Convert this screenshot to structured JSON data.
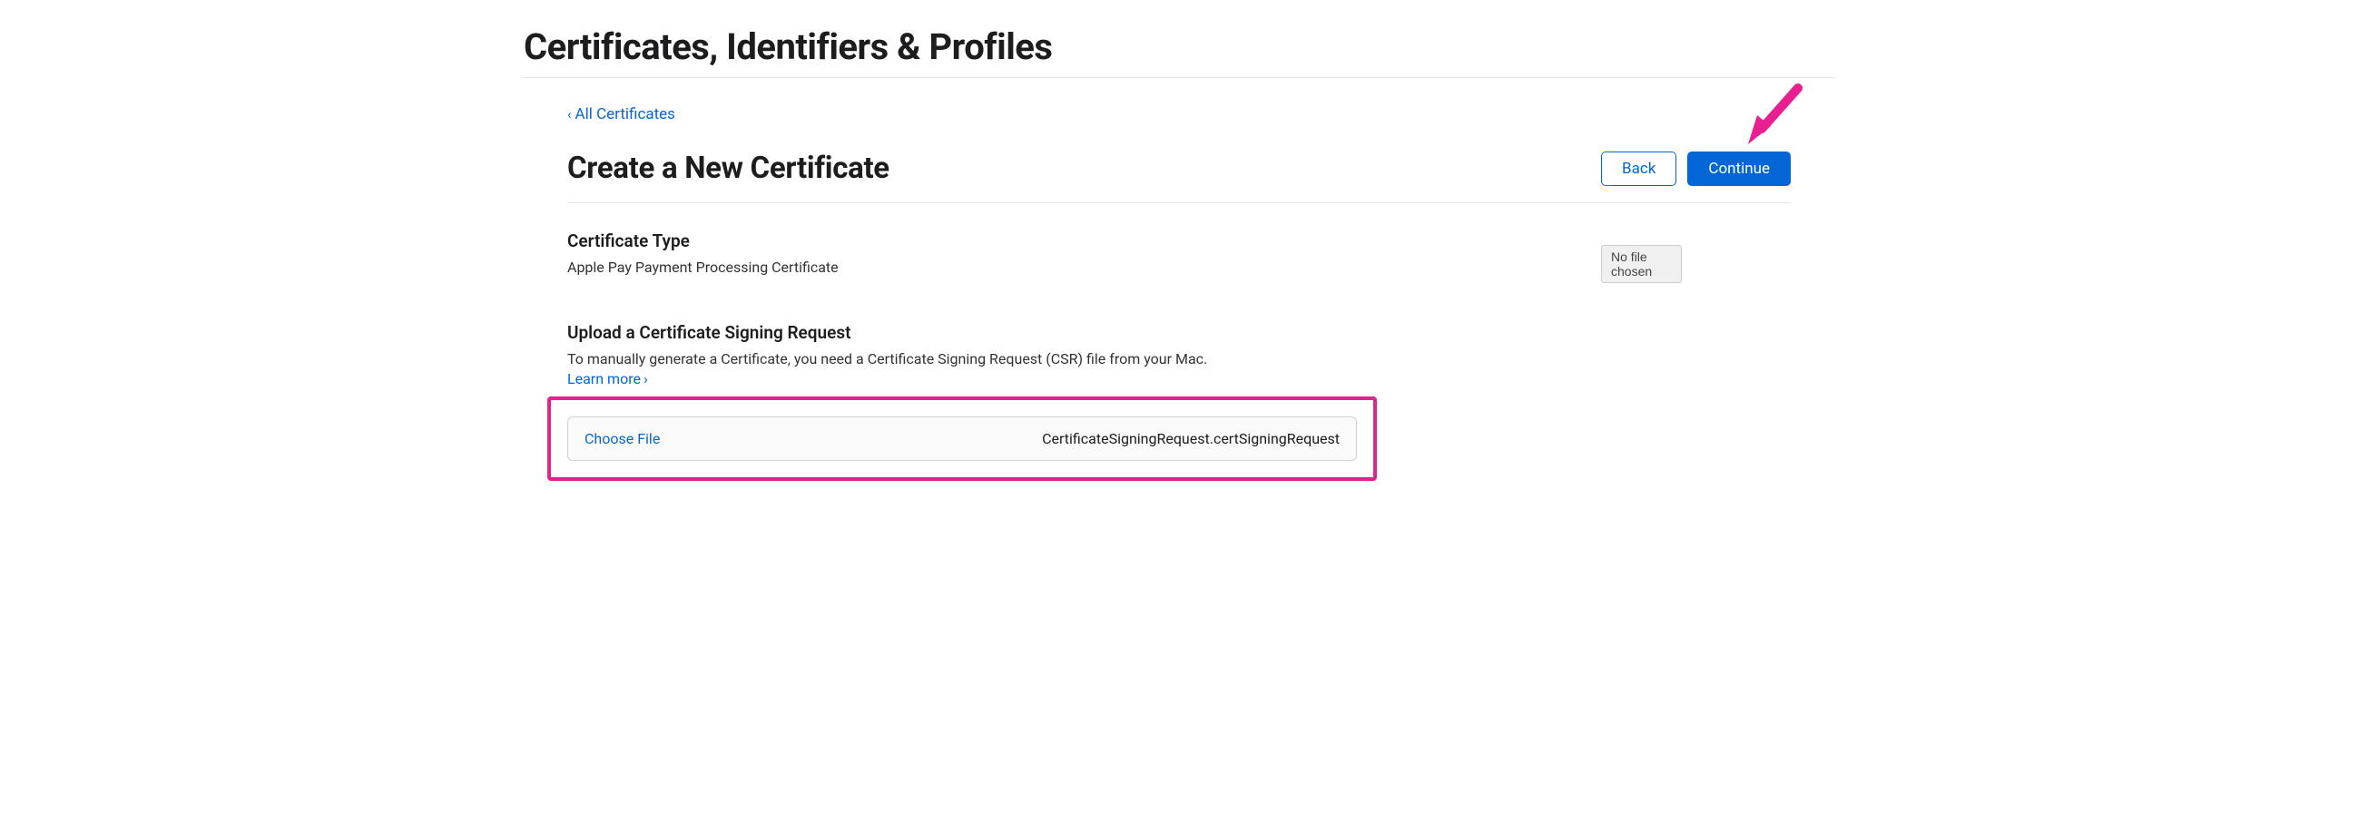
{
  "page": {
    "main_title": "Certificates, Identifiers & Profiles",
    "breadcrumb": {
      "label": "All Certificates"
    },
    "sub_title": "Create a New Certificate",
    "buttons": {
      "back": "Back",
      "continue": "Continue"
    },
    "certificate_type": {
      "title": "Certificate Type",
      "value": "Apple Pay Payment Processing Certificate"
    },
    "upload": {
      "title": "Upload a Certificate Signing Request",
      "description": "To manually generate a Certificate, you need a Certificate Signing Request (CSR) file from your Mac.",
      "learn_more": "Learn more"
    },
    "file_picker": {
      "choose_label": "Choose File",
      "filename": "CertificateSigningRequest.certSigningRequest"
    },
    "tooltip": "No file chosen"
  },
  "annotation": {
    "arrow_color": "#e91e90",
    "highlight_color": "#e91e90"
  }
}
